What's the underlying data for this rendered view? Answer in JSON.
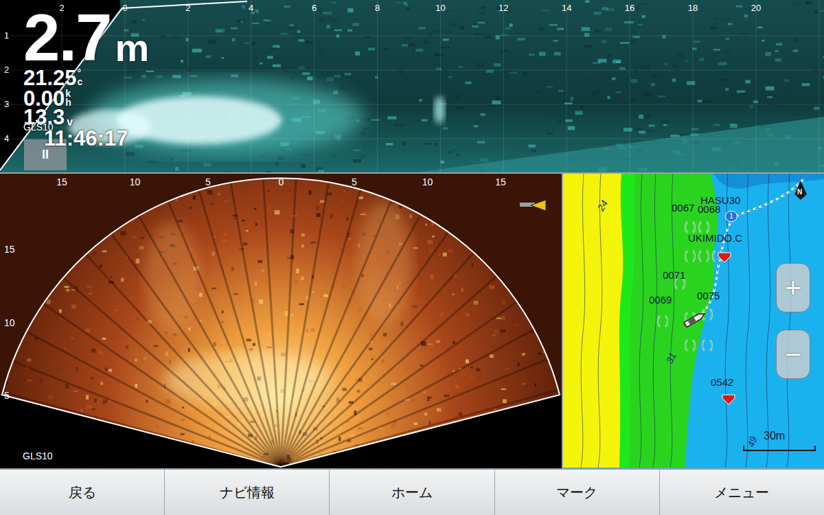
{
  "top_sonar": {
    "depth": "2.7",
    "depth_unit": "m",
    "temperature": "21.25",
    "temp_degree": "°",
    "temp_unit": "c",
    "speed": "0.00",
    "speed_unit_top": "k",
    "speed_unit_bottom": "h",
    "voltage": "13.3",
    "voltage_unit": "v",
    "source": "GLS10",
    "time": "11:46:17",
    "pause": "II",
    "range_ticks": [
      "2",
      "0",
      "2",
      "4",
      "6",
      "8",
      "10",
      "12",
      "14",
      "16",
      "18",
      "20"
    ],
    "depth_ticks": [
      "1",
      "2",
      "3",
      "4"
    ]
  },
  "live_sonar": {
    "source": "GLS10",
    "range_ticks": [
      "15",
      "10",
      "5",
      "0",
      "5",
      "10",
      "15"
    ],
    "depth_ticks": [
      "15",
      "10",
      "5"
    ]
  },
  "map": {
    "north": "N",
    "contour_labels": [
      "24",
      "31",
      "49"
    ],
    "route_label": "HASU30",
    "route_point": "1",
    "waypoints": [
      {
        "name": "0067",
        "kind": "fish"
      },
      {
        "name": "0068",
        "kind": "fish"
      },
      {
        "name": "UKIMIDO.C",
        "kind": "flag"
      },
      {
        "name": "0071",
        "kind": "fish"
      },
      {
        "name": "0069",
        "kind": "fish"
      },
      {
        "name": "0075",
        "kind": "fish"
      },
      {
        "name": "0542",
        "kind": "flag"
      }
    ],
    "zoom_in": "+",
    "zoom_out": "−",
    "scale": "30m"
  },
  "nav_buttons": [
    {
      "label": "戻る",
      "selected": false
    },
    {
      "label": "ナビ情報",
      "selected": false
    },
    {
      "label": "ホーム",
      "selected": false
    },
    {
      "label": "マーク",
      "selected": false
    },
    {
      "label": "メニュー",
      "selected": false
    }
  ]
}
